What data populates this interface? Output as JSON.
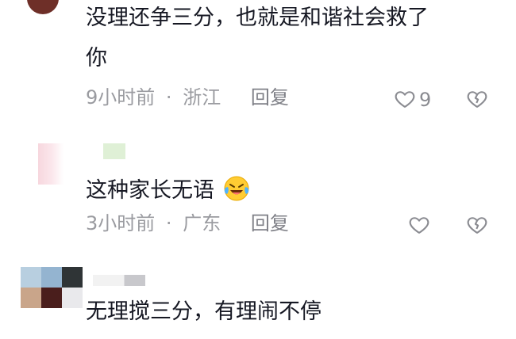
{
  "comments": [
    {
      "text_lines": [
        "没理还争三分，也就是和谐社会救了",
        "你"
      ],
      "time": "9小时前",
      "sep": "·",
      "location": "浙江",
      "reply_label": "回复",
      "like_count": "9",
      "like_icon": "heart-outline-icon",
      "dislike_icon": "broken-heart-icon"
    },
    {
      "text": "这种家长无语",
      "emoji": "crying-laughing-emoji",
      "time": "3小时前",
      "sep": "·",
      "location": "广东",
      "reply_label": "回复",
      "like_icon": "heart-outline-icon",
      "dislike_icon": "broken-heart-icon"
    },
    {
      "text": "无理搅三分，有理闹不停"
    }
  ],
  "colors": {
    "text": "#161823",
    "meta": "#9a9ba0",
    "avatar1": "#6e2f28",
    "avatar2_pink": "#f7d7de",
    "avatar3_tile_blue": "#9bb7cf"
  }
}
